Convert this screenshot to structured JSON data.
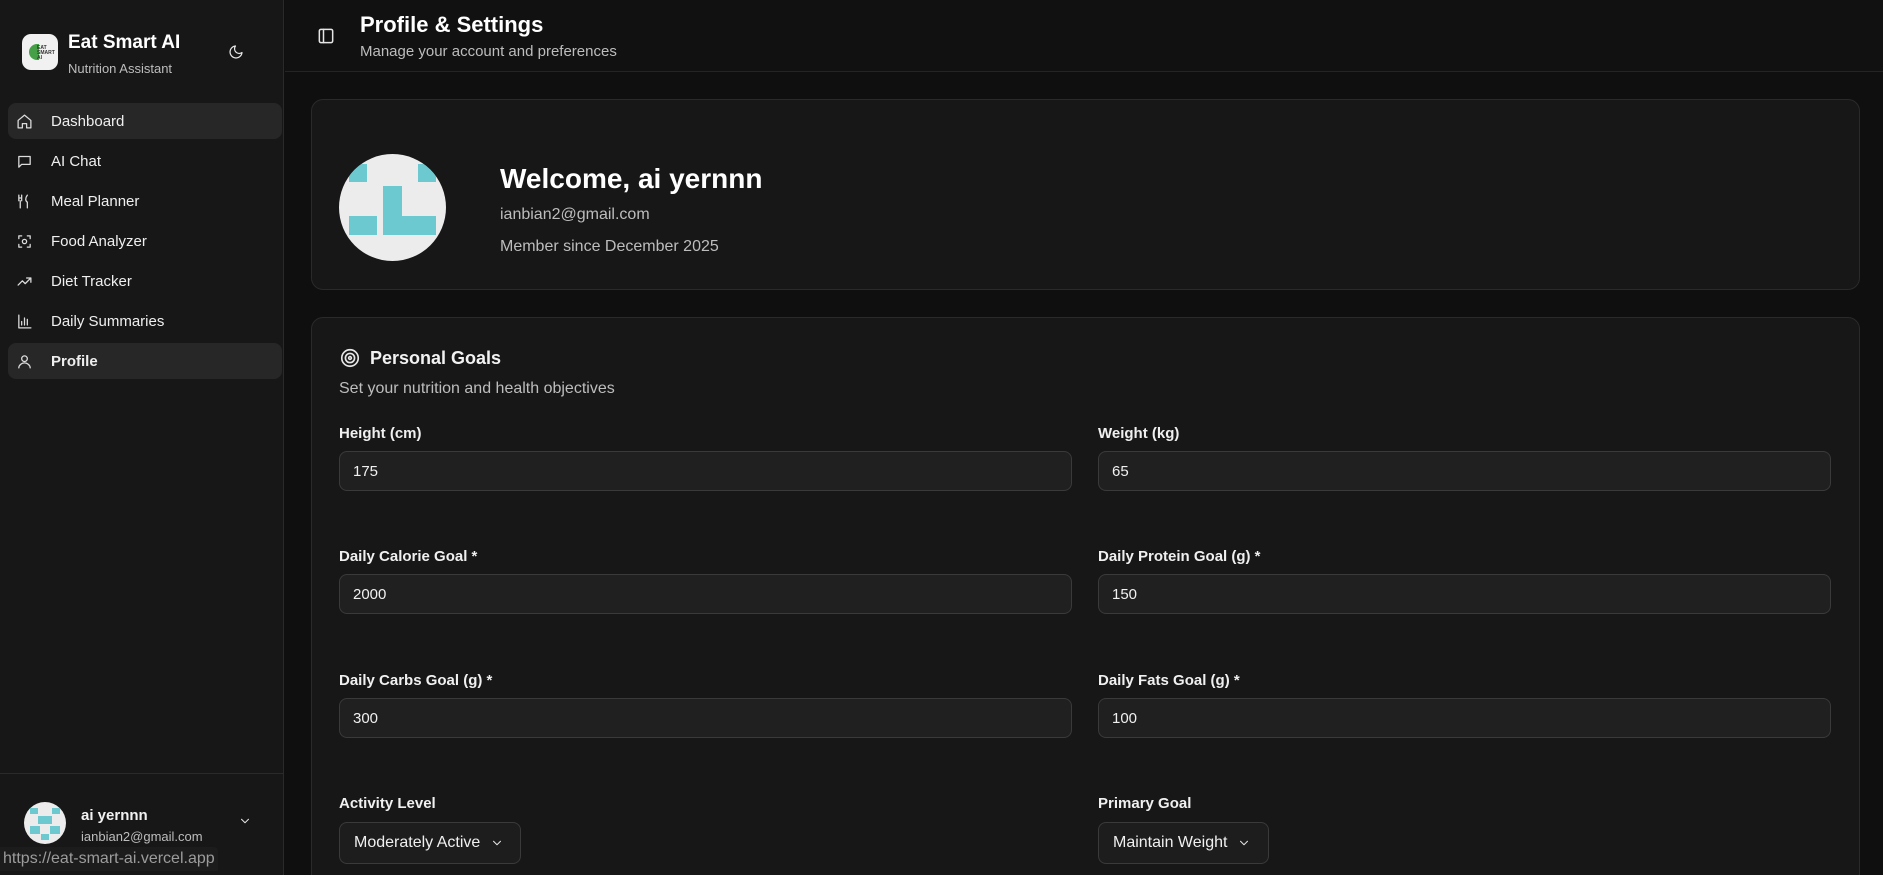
{
  "brand": {
    "logo_text": "EAT SMART AI",
    "title": "Eat Smart AI",
    "subtitle": "Nutrition Assistant",
    "icon": "moon-icon"
  },
  "sidebar": {
    "items": [
      {
        "label": "Dashboard",
        "icon": "home-icon",
        "active": true
      },
      {
        "label": "AI Chat",
        "icon": "chat-icon"
      },
      {
        "label": "Meal Planner",
        "icon": "utensils-icon"
      },
      {
        "label": "Food Analyzer",
        "icon": "scan-icon"
      },
      {
        "label": "Diet Tracker",
        "icon": "trending-up-icon"
      },
      {
        "label": "Daily Summaries",
        "icon": "bar-chart-icon"
      },
      {
        "label": "Profile",
        "icon": "user-icon",
        "active": true
      }
    ]
  },
  "footer_user": {
    "name": "ai yernnn",
    "email": "ianbian2@gmail.com"
  },
  "status_url": "https://eat-smart-ai.vercel.app",
  "header": {
    "title": "Profile & Settings",
    "subtitle": "Manage your account and preferences"
  },
  "profile": {
    "welcome": "Welcome, ai yernnn",
    "email": "ianbian2@gmail.com",
    "member_since": "Member since December 2025"
  },
  "goals": {
    "title": "Personal Goals",
    "subtitle": "Set your nutrition and health objectives",
    "height_label": "Height (cm)",
    "height_value": "175",
    "weight_label": "Weight (kg)",
    "weight_value": "65",
    "calorie_label": "Daily Calorie Goal *",
    "calorie_value": "2000",
    "protein_label": "Daily Protein Goal (g) *",
    "protein_value": "150",
    "carbs_label": "Daily Carbs Goal (g) *",
    "carbs_value": "300",
    "fats_label": "Daily Fats Goal (g) *",
    "fats_value": "100",
    "activity_label": "Activity Level",
    "activity_value": "Moderately Active",
    "primary_goal_label": "Primary Goal",
    "primary_goal_value": "Maintain Weight"
  },
  "colors": {
    "avatar_teal": "#6cc9d0",
    "background": "#0f0f0f",
    "card": "#171717"
  }
}
